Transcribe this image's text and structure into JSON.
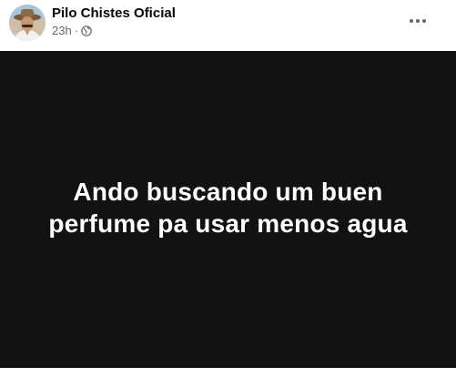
{
  "post": {
    "page_name": "Pilo Chistes Oficial",
    "timestamp": "23h",
    "separator": "·",
    "audience_icon": "globe-icon",
    "options_icon": "more-horizontal-icon",
    "text_line_1": "Ando buscando um buen",
    "text_line_2": "perfume pa usar menos agua"
  },
  "colors": {
    "name": "#050505",
    "meta": "#65676b",
    "post_background": "#121212",
    "post_text": "#ffffff"
  }
}
